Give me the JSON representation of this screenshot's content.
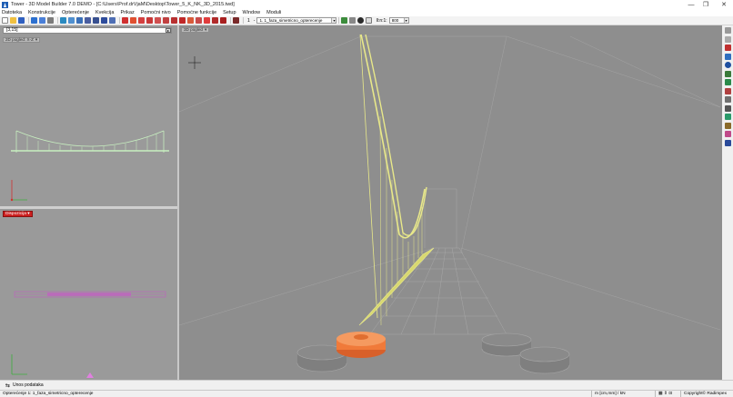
{
  "window": {
    "title": "Tower - 3D Model Builder 7.0 DEMO - [C:\\Users\\Prof.drVjaM\\Desktop\\Tower_5_K_NK_3D_2015.twd]",
    "minimize": "—",
    "maximize": "❐",
    "close": "✕"
  },
  "menu": {
    "items": [
      "Datoteka",
      "Konstrukcije",
      "Opterećenje",
      "Kvekcija",
      "Prikaz",
      "Pomoćni nivo",
      "Pomoćne funkcije",
      "Setup",
      "Window",
      "Moduli"
    ]
  },
  "toolbar": {
    "case_number": "1",
    "case_sep": "-",
    "load_case": "1. 1_faza_simetricno_opterecenje",
    "ratio_label": "Il:n:1:",
    "ratio_value": "800"
  },
  "left_panel": {
    "coord_value": "[3,15]",
    "coord_btn": "▸",
    "top_view_tag": "2D pogled: X-Z",
    "disp_tag": "Dispozicija"
  },
  "main_view": {
    "view_tag": "3D pogled"
  },
  "bottom": {
    "tab_label": "Unos podataka"
  },
  "status": {
    "left_text": "Opterećenje 1: 1_faza_simetricno_opterecenje",
    "units": "m [cm,mm] / kN",
    "copyright": "Copyright© Radimpex"
  },
  "colors": {
    "viewport_bg": "#8e8e8e",
    "cable_yellow": "#e8e88a",
    "pylon_orange": "#f07a3a",
    "accent_red": "#cc2020",
    "side_view_green": "#c8f0c0",
    "plan_view_magenta": "#c060c0"
  },
  "icons": {
    "app": "tower-app-icon",
    "axis": "axis-cross-icon"
  }
}
